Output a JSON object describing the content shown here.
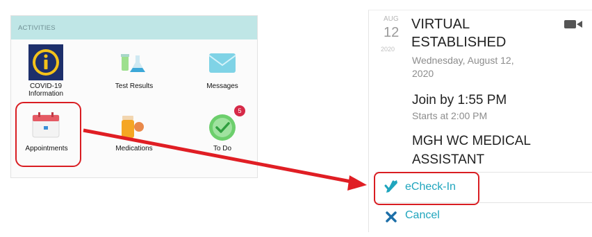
{
  "activities": {
    "header": "ACTIVITIES",
    "tiles": [
      {
        "label": "COVID-19 Information",
        "icon": "info-icon"
      },
      {
        "label": "Test Results",
        "icon": "test-tubes-icon"
      },
      {
        "label": "Messages",
        "icon": "envelope-icon"
      },
      {
        "label": "Appointments",
        "icon": "calendar-icon"
      },
      {
        "label": "Medications",
        "icon": "pill-bottle-icon"
      },
      {
        "label": "To Do",
        "icon": "checkmark-circle-icon",
        "badge": "5"
      }
    ]
  },
  "appointment": {
    "month": "AUG",
    "day": "12",
    "year": "2020",
    "type": "VIRTUAL ESTABLISHED",
    "full_date": "Wednesday, August 12, 2020",
    "join_by": "Join by 1:55 PM",
    "starts_at": "Starts at 2:00 PM",
    "department": "MGH WC MEDICAL ASSISTANT",
    "video_icon": "video-camera-icon",
    "echeckin_label": "eCheck-In",
    "cancel_label": "Cancel"
  },
  "colors": {
    "highlight": "#d91d22",
    "link": "#1fa5bd",
    "header_bg": "#bfe6e6"
  }
}
